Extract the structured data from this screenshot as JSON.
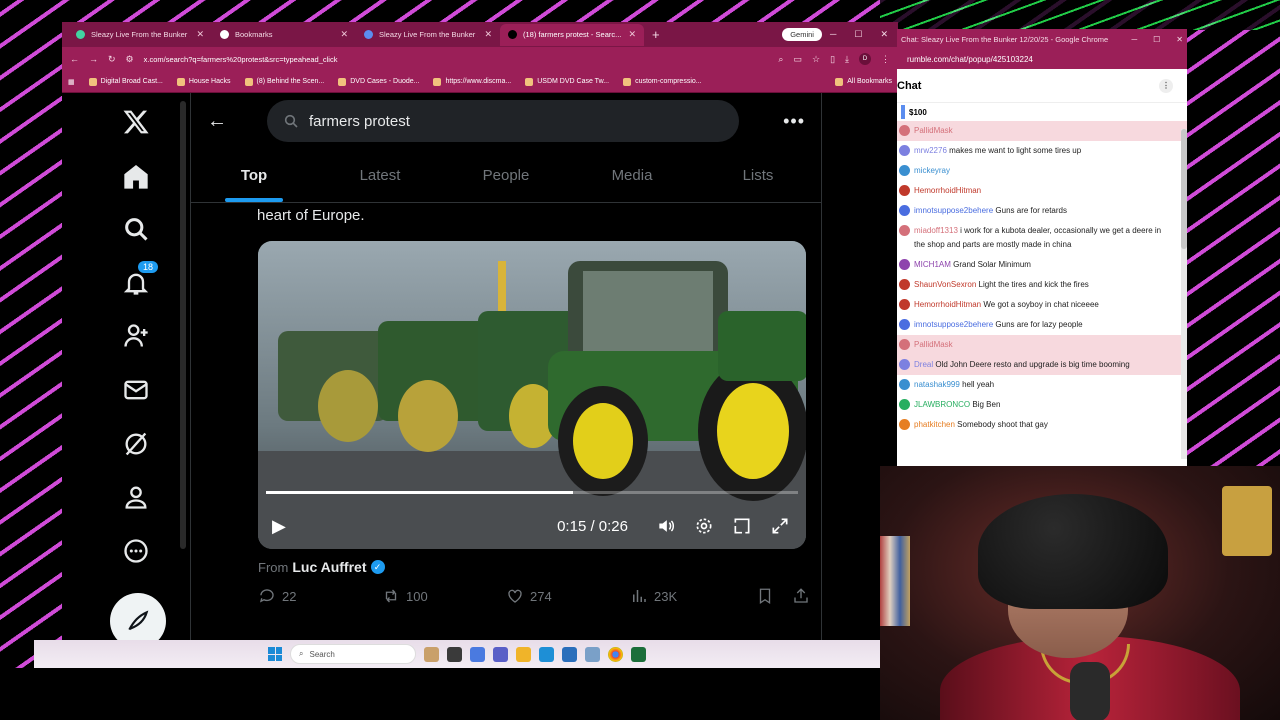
{
  "browser": {
    "tabs": [
      {
        "title": "Sleazy Live From the Bunker 12/...",
        "fav": "#42d3a2",
        "active": false
      },
      {
        "title": "Bookmarks",
        "fav": "#ffffff",
        "active": false
      },
      {
        "title": "Sleazy Live From the Bunker 12/...",
        "fav": "#5b8def",
        "active": false
      },
      {
        "title": "(18) farmers protest - Searc...",
        "fav": "#000000",
        "active": true
      }
    ],
    "new_tab": "+",
    "gemini": "Gemini",
    "url": "x.com/search?q=farmers%20protest&src=typeahead_click",
    "profile_initial": "D",
    "bookmarks": [
      "Digital Broad Cast...",
      "House Hacks",
      "(8) Behind the Scen...",
      "DVD Cases - Duode...",
      "https://www.discma...",
      "USDM DVD Case Tw...",
      "custom-compressio..."
    ],
    "all_bookmarks": "All Bookmarks"
  },
  "x": {
    "notif_count": "18",
    "search_query": "farmers protest",
    "tabs": [
      "Top",
      "Latest",
      "People",
      "Media",
      "Lists"
    ],
    "tweet_text": "heart of Europe.",
    "video": {
      "current": "0:15",
      "duration": "0:26",
      "time_display": "0:15 / 0:26",
      "progress": 0.577
    },
    "from_label": "From",
    "from_user": "Luc Auffret",
    "replies": "22",
    "reposts": "100",
    "likes": "274",
    "views": "23K"
  },
  "taskbar": {
    "search_placeholder": "Search"
  },
  "chat": {
    "window_title": "Chat: Sleazy Live From the Bunker 12/20/25 - Google Chrome",
    "url": "rumble.com/chat/popup/425103224",
    "header": "Chat",
    "rant_amount": "$100",
    "messages": [
      {
        "user": "PallidMask",
        "color": "#d4707a",
        "text": "",
        "pink": true
      },
      {
        "user": "mrw2276",
        "color": "#7c80e0",
        "text": "makes me want to light some tires up",
        "pink": false
      },
      {
        "user": "mickeyray",
        "color": "#3a8fd0",
        "text": "",
        "pink": false
      },
      {
        "user": "HemorrhoidHitman",
        "color": "#c0392b",
        "text": "",
        "pink": false
      },
      {
        "user": "imnotsuppose2behere",
        "color": "#4a6de0",
        "text": "Guns are for retards",
        "pink": false
      },
      {
        "user": "miadoff1313",
        "color": "#d4707a",
        "text": "i work for a kubota dealer, occasionally we get a deere in the shop and parts are mostly made in china",
        "pink": false
      },
      {
        "user": "MICH1AM",
        "color": "#8e44ad",
        "text": "Grand Solar Minimum",
        "pink": false
      },
      {
        "user": "ShaunVonSexron",
        "color": "#c0392b",
        "text": "Light the tires and kick the fires",
        "pink": false
      },
      {
        "user": "HemorrhoidHitman",
        "color": "#c0392b",
        "text": "We got a soyboy in chat niceeee",
        "pink": false
      },
      {
        "user": "imnotsuppose2behere",
        "color": "#4a6de0",
        "text": "Guns are for lazy people",
        "pink": false
      },
      {
        "user": "PallidMask",
        "color": "#d4707a",
        "text": "",
        "pink": true
      },
      {
        "user": "Dreal",
        "color": "#7c80e0",
        "text": "Old John Deere resto and upgrade is big time booming",
        "pink": true
      },
      {
        "user": "natashak999",
        "color": "#3a8fd0",
        "text": "hell yeah",
        "pink": false
      },
      {
        "user": "JLAWBRONCO",
        "color": "#27ae60",
        "text": "Big Ben",
        "pink": false
      },
      {
        "user": "phatkitchen",
        "color": "#e67e22",
        "text": "Somebody shoot that gay",
        "pink": false
      }
    ]
  }
}
